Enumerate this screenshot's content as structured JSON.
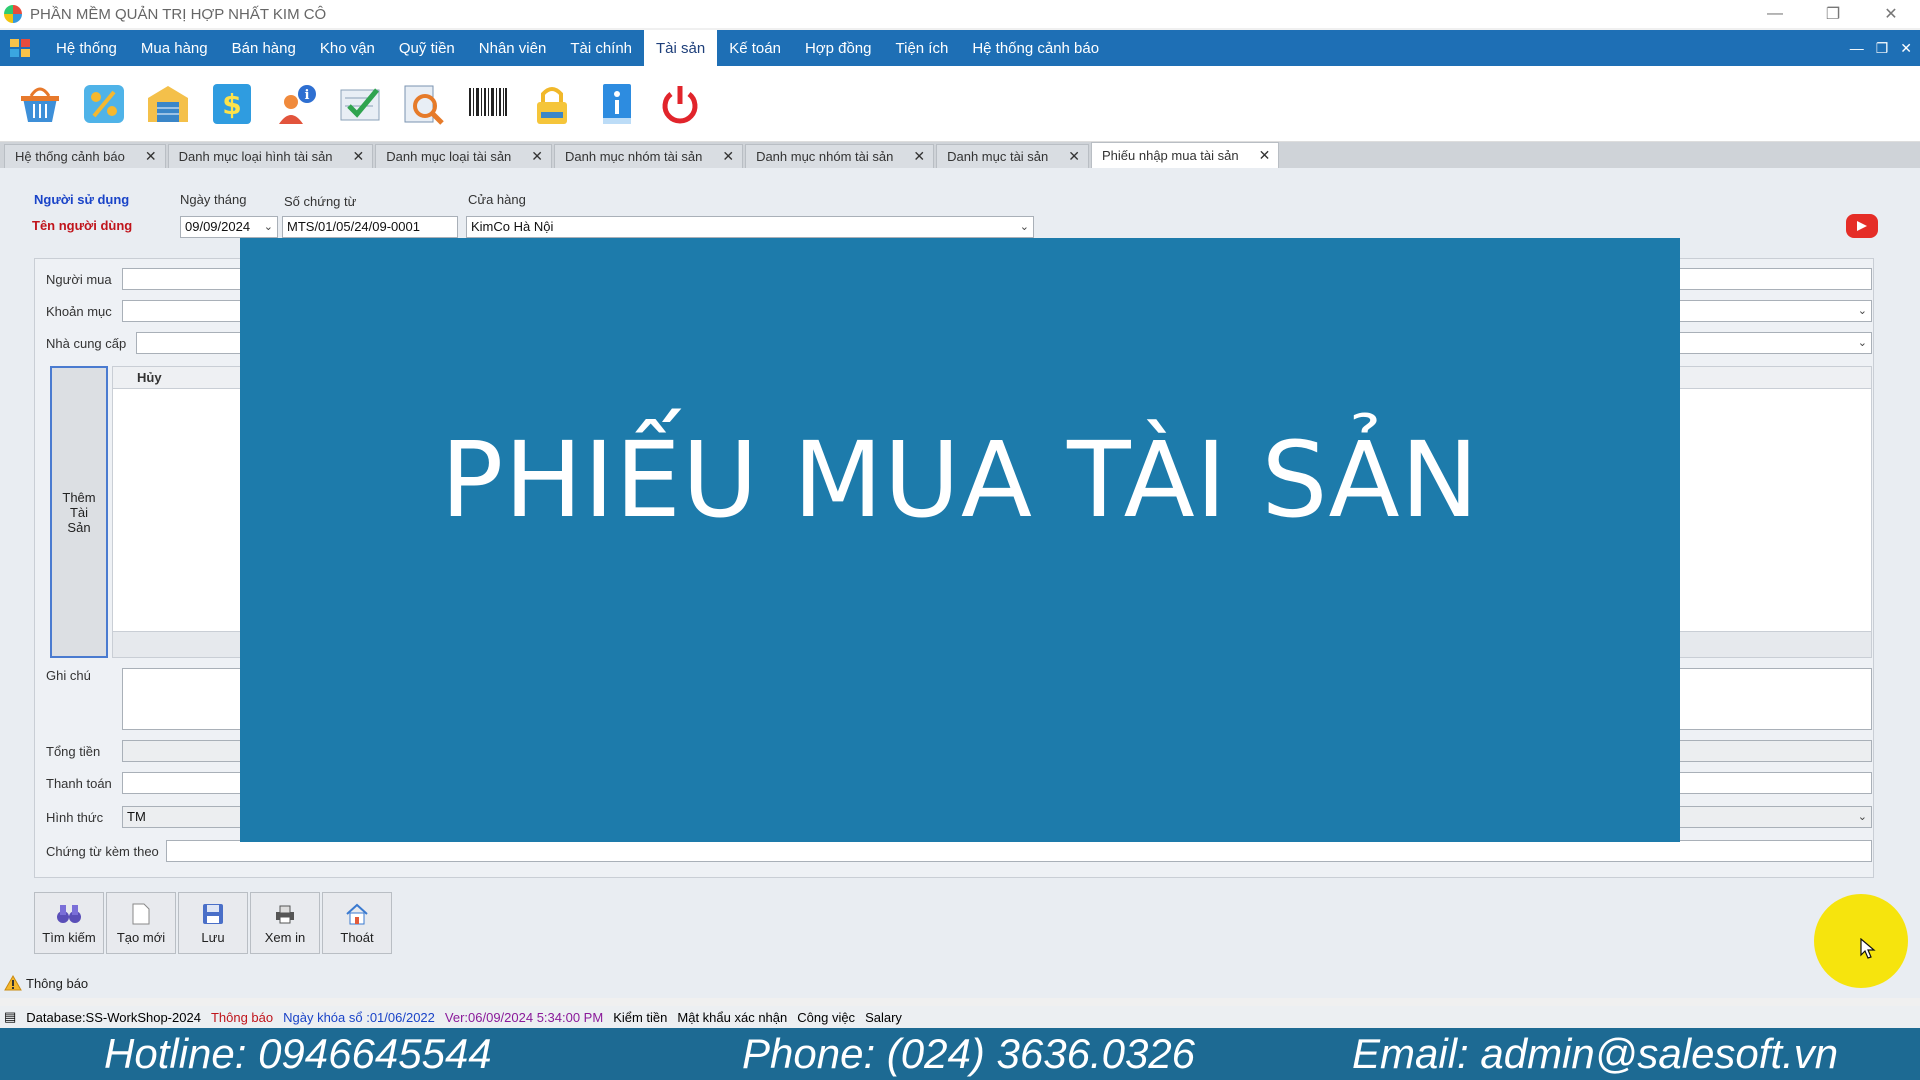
{
  "window": {
    "title": "PHẦN MỀM QUẢN TRỊ HỢP NHẤT KIM CÔ"
  },
  "menu": {
    "items": [
      "Hệ thống",
      "Mua hàng",
      "Bán hàng",
      "Kho vận",
      "Quỹ tiền",
      "Nhân viên",
      "Tài chính",
      "Tài sản",
      "Kế toán",
      "Hợp đồng",
      "Tiện ích",
      "Hệ thống cảnh báo"
    ],
    "active": "Tài sản"
  },
  "toolbar": {
    "icons": [
      "basket-icon",
      "percent-icon",
      "warehouse-icon",
      "money-icon",
      "user-info-icon",
      "approve-icon",
      "search-doc-icon",
      "barcode-icon",
      "lock-icon",
      "info-book-icon",
      "power-icon"
    ]
  },
  "tabs": [
    {
      "label": "Hệ thống cảnh báo"
    },
    {
      "label": "Danh mục loại hình tài sản"
    },
    {
      "label": "Danh mục loại tài sản"
    },
    {
      "label": "Danh mục nhóm tài sản"
    },
    {
      "label": "Danh mục nhóm tài sản"
    },
    {
      "label": "Danh mục tài sản"
    },
    {
      "label": "Phiếu nhập mua tài sản"
    }
  ],
  "header": {
    "user_label": "Người sử dụng",
    "username_label": "Tên người dùng",
    "date_label": "Ngày tháng",
    "date_value": "09/09/2024",
    "voucher_label": "Số chứng từ",
    "voucher_value": "MTS/01/05/24/09-0001",
    "store_label": "Cửa hàng",
    "store_value": "KimCo Hà Nội"
  },
  "form": {
    "buyer_label": "Người mua",
    "category_label": "Khoản mục",
    "supplier_label": "Nhà cung cấp",
    "add_asset_label": "Thêm Tài Sản",
    "grid_col_cancel": "Hủy",
    "note_label": "Ghi chú",
    "total_label": "Tổng tiền",
    "payment_label": "Thanh toán",
    "method_label": "Hình thức",
    "method_value": "TM",
    "attached_label": "Chứng từ kèm theo"
  },
  "overlay": {
    "banner": "PHIẾU MUA TÀI SẢN"
  },
  "buttons": {
    "search": "Tìm kiếm",
    "new": "Tạo mới",
    "save": "Lưu",
    "print": "Xem in",
    "exit": "Thoát"
  },
  "notice": {
    "label": "Thông báo"
  },
  "status": {
    "database": "Database:SS-WorkShop-2024",
    "notice": "Thông báo",
    "lock_date": "Ngày khóa sổ :01/06/2022",
    "version": "Ver:06/09/2024 5:34:00 PM",
    "check_money": "Kiểm tiền",
    "password": "Mật khẩu xác nhận",
    "work": "Công việc",
    "salary": "Salary"
  },
  "contact": {
    "hotline": "Hotline: 0946645544",
    "phone": "Phone: (024) 3636.0326",
    "email": "Email: admin@salesoft.vn"
  },
  "colors": {
    "menubar": "#1e6fb5",
    "overlay": "#1d7bab",
    "contact_bar": "#1d6a93",
    "highlight": "#f7e400"
  }
}
